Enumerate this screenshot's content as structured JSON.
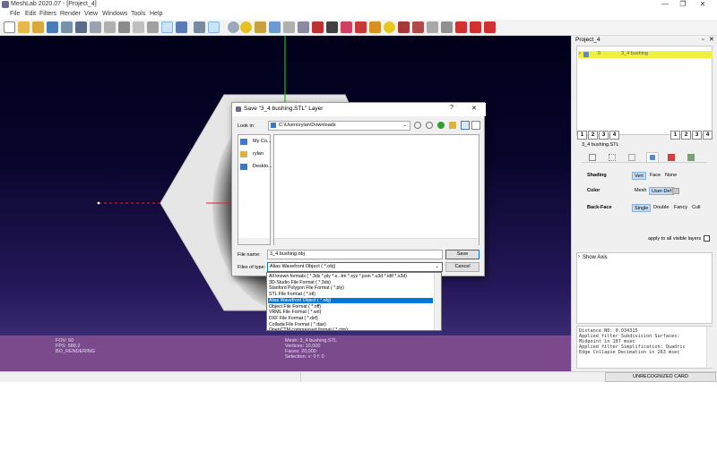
{
  "window": {
    "title": "MeshLab 2020.07 - [Project_4]"
  },
  "menu": [
    "File",
    "Edit",
    "Filters",
    "Render",
    "View",
    "Windows",
    "Tools",
    "Help"
  ],
  "viewport_info": {
    "left": [
      "FOV: 60",
      "FPS:   588.2",
      "BO_RENDERING"
    ],
    "center": [
      "Mesh: 3_4 bushing.STL",
      "Vertices: 10,000",
      "Faces: 20,000",
      "Selection: v: 0 f: 0"
    ]
  },
  "right_panel": {
    "project_title": "Project_4",
    "layer": {
      "index": "0",
      "name": "3_4 bushing"
    },
    "numbers": [
      "1",
      "2",
      "3",
      "4"
    ],
    "mesh_name": "3_4 bushing.STL",
    "shading": {
      "label": "Shading",
      "options": [
        "Vert",
        "Face",
        "None"
      ],
      "selected": "Vert"
    },
    "color": {
      "label": "Color",
      "options": [
        "Mesh",
        "User-Def"
      ],
      "selected": "User-Def"
    },
    "backface": {
      "label": "Back-Face",
      "options": [
        "Single",
        "Double",
        "Fancy",
        "Cull"
      ],
      "selected": "Single"
    },
    "apply_all": "apply to all visible layers",
    "show_axis": "Show Axis",
    "log": [
      "Distance N0: 0.034315",
      "Applied filter Subdivision Surfaces:",
      "Midpoint in 107 msec",
      "Applied filter Simplification: Quadric",
      "Edge Collapse Decimation in 263 msec"
    ]
  },
  "status": {
    "right": "UNRECOGNIZED CARD"
  },
  "dialog": {
    "title": "Save \"3_4 bushing.STL\" Layer",
    "help": "?",
    "look_in_label": "Look in:",
    "look_in_value": "C:\\Users\\rylan\\Downloads",
    "sidebar": [
      "My Co...",
      "rylan",
      "Deskto..."
    ],
    "file_name_label": "File name:",
    "file_name_value": "3_4 bushing.obj",
    "file_type_label": "Files of type:",
    "file_type_value": "Alias Wavefront Object ( *.obj)",
    "save": "Save",
    "cancel": "Cancel",
    "file_types": [
      "All known formats ( *.3ds *.ply *.s...tm *.xyz *.json *.u3d *.idtf *.x3d)",
      "3D-Studio File Format ( *.3ds)",
      "Stanford Polygon File Format ( *.ply)",
      "STL File Format ( *.stl)",
      "Alias Wavefront Object ( *.obj)",
      "Object File Format ( *.off)",
      "VRML File Format ( *.wrl)",
      "DXF File Format ( *.dxf)",
      "Collada File Format ( *.dae)",
      "OpenCTM compressed format ( *.ctm)"
    ],
    "selected_type_index": 4
  },
  "colors": {
    "viewport_top": "#00001a",
    "info_bar": "#7a4a8c",
    "layer_highlight": "#f0f040",
    "selection": "#0078d7",
    "toggle_selected": "#c6dcf2"
  }
}
